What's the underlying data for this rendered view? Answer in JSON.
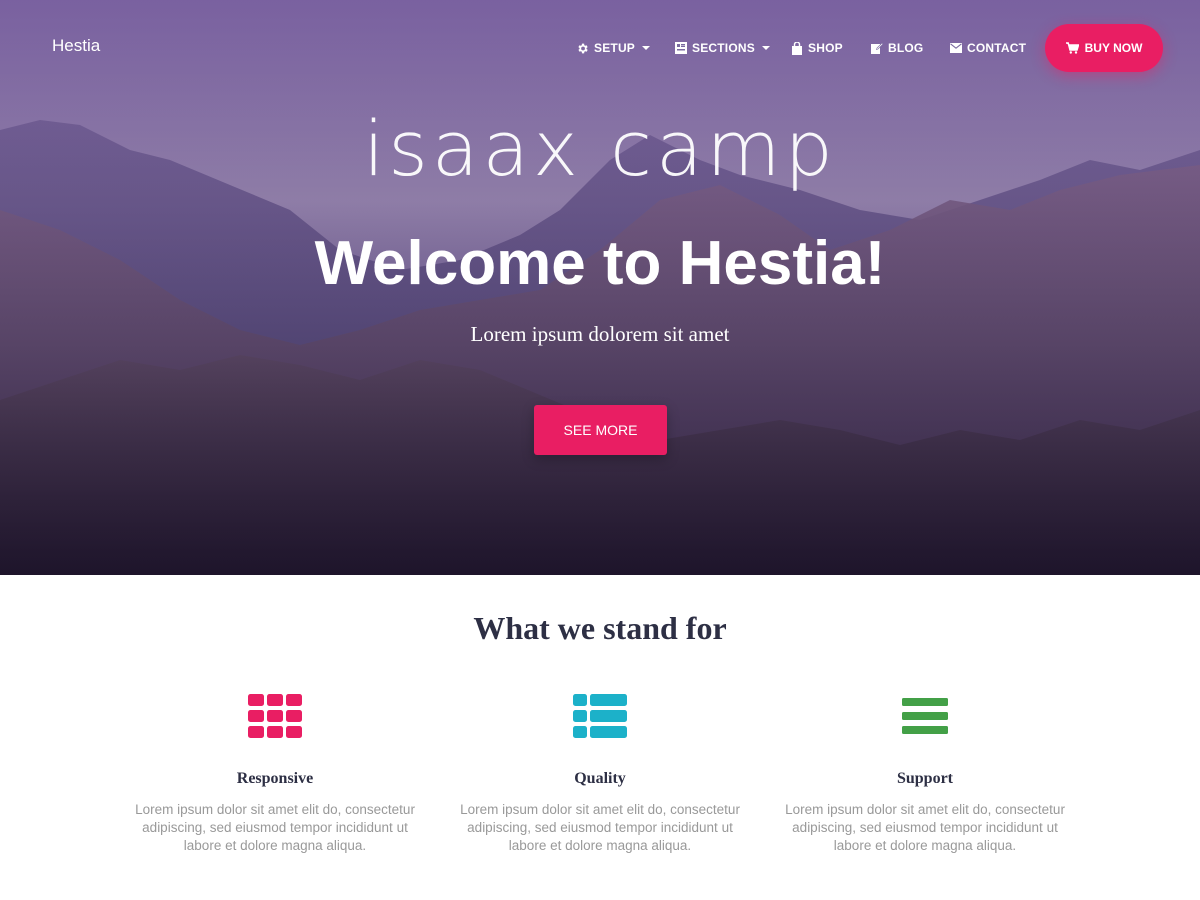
{
  "colors": {
    "accent": "#e91e63",
    "quality": "#1cb1c9",
    "support": "#43a047",
    "heading": "#2d2f44",
    "muted": "#999999"
  },
  "navbar": {
    "brand": "Hestia",
    "items": [
      {
        "label": "SETUP",
        "icon": "gear-icon",
        "dropdown": true
      },
      {
        "label": "SECTIONS",
        "icon": "sections-icon",
        "dropdown": true
      },
      {
        "label": "SHOP",
        "icon": "shop-bag-icon",
        "dropdown": false
      },
      {
        "label": "BLOG",
        "icon": "blog-edit-icon",
        "dropdown": false
      },
      {
        "label": "CONTACT",
        "icon": "envelope-icon",
        "dropdown": false
      }
    ],
    "buy_now": {
      "label": "BUY NOW",
      "icon": "cart-icon"
    }
  },
  "hero": {
    "logo_text": "isaax camp",
    "title": "Welcome to Hestia!",
    "subtitle": "Lorem ipsum dolorem sit amet",
    "cta": "SEE MORE"
  },
  "features": {
    "title": "What we stand for",
    "items": [
      {
        "icon": "grid-icon",
        "title": "Responsive",
        "text": "Lorem ipsum dolor sit amet elit do, consectetur adipiscing, sed eiusmod tempor incididunt ut labore et dolore magna aliqua."
      },
      {
        "icon": "list-icon",
        "title": "Quality",
        "text": "Lorem ipsum dolor sit amet elit do, consectetur adipiscing, sed eiusmod tempor incididunt ut labore et dolore magna aliqua."
      },
      {
        "icon": "bars-icon",
        "title": "Support",
        "text": "Lorem ipsum dolor sit amet elit do, consectetur adipiscing, sed eiusmod tempor incididunt ut labore et dolore magna aliqua."
      }
    ]
  }
}
